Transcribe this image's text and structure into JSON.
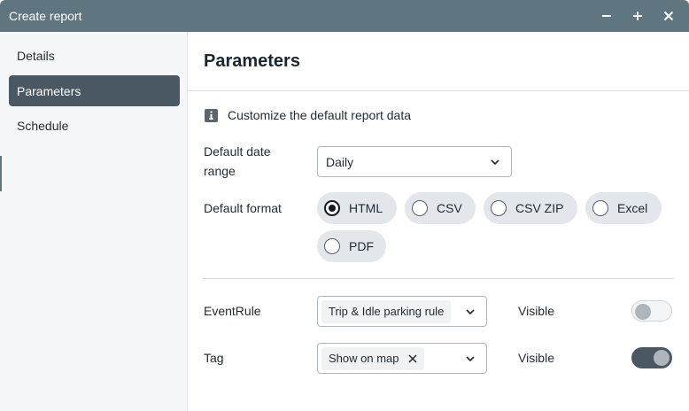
{
  "window": {
    "title": "Create report"
  },
  "sidebar": {
    "items": [
      {
        "label": "Details",
        "active": false
      },
      {
        "label": "Parameters",
        "active": true
      },
      {
        "label": "Schedule",
        "active": false
      }
    ]
  },
  "main": {
    "title": "Parameters",
    "info_text": "Customize the default report data",
    "date_range": {
      "label_line1": "Default date",
      "label_line2": "range",
      "value": "Daily"
    },
    "format": {
      "label": "Default format",
      "options": [
        "HTML",
        "CSV",
        "CSV ZIP",
        "Excel",
        "PDF"
      ],
      "selected": "HTML"
    },
    "event_rule": {
      "label": "EventRule",
      "chip": "Trip & Idle parking rule",
      "visible_label": "Visible",
      "visible": false
    },
    "tag": {
      "label": "Tag",
      "chip": "Show on map",
      "visible_label": "Visible",
      "visible": true
    }
  },
  "colors": {
    "titlebar": "#5f7680",
    "nav_active": "#4a5863",
    "pill_bg": "#e3e6ea",
    "toggle_on": "#4a5863"
  },
  "icons": [
    "minimize-icon",
    "maximize-icon",
    "close-icon",
    "info-icon",
    "chevron-down-icon",
    "remove-chip-icon"
  ]
}
